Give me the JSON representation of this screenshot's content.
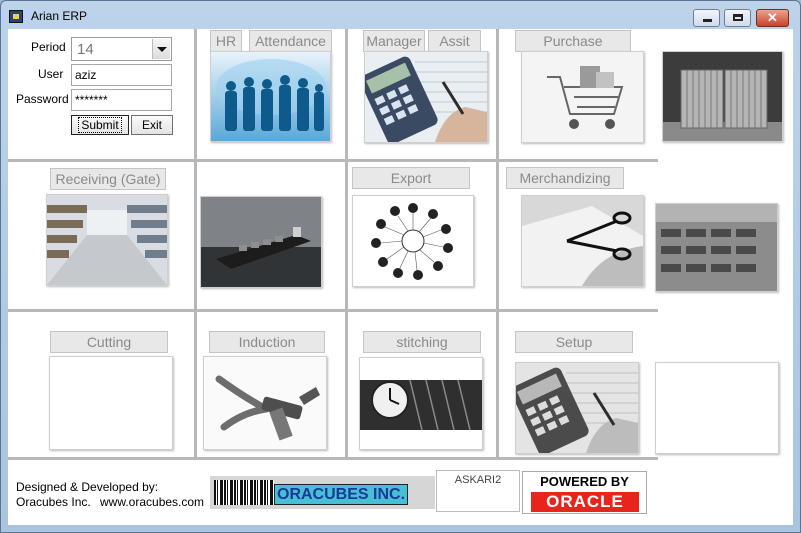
{
  "window": {
    "title": "Arian ERP",
    "minimize_label": "minimize",
    "maximize_label": "maximize",
    "close_glyph": "✕"
  },
  "login": {
    "period_label": "Period",
    "period_value": "14",
    "user_label": "User",
    "user_value": "aziz",
    "password_label": "Password",
    "password_value": "*******",
    "submit_label": "Submit",
    "exit_label": "Exit"
  },
  "modules": {
    "hr": "HR",
    "attendance": "Attendance",
    "manager": "Manager",
    "assit": "Assit",
    "purchase": "Purchase",
    "receiving": "Receiving (Gate)",
    "export": "Export",
    "merchandizing": "Merchandizing",
    "cutting": "Cutting",
    "induction": "Induction",
    "stitching": "stitching",
    "setup": "Setup"
  },
  "footer": {
    "designed_by": "Designed & Developed by:",
    "company": "Oracubes Inc.",
    "website": "www.oracubes.com",
    "barcode_text": "ORACUBES INC.",
    "server_name": "ASKARI2",
    "powered_by": "POWERED BY",
    "oracle_logo_text": "ORACLE"
  },
  "colors": {
    "title_bar": "#bcd3ea",
    "close_button": "#c8432b",
    "oracle_red": "#e8251c",
    "barcode_highlight": "#47bfd7"
  }
}
